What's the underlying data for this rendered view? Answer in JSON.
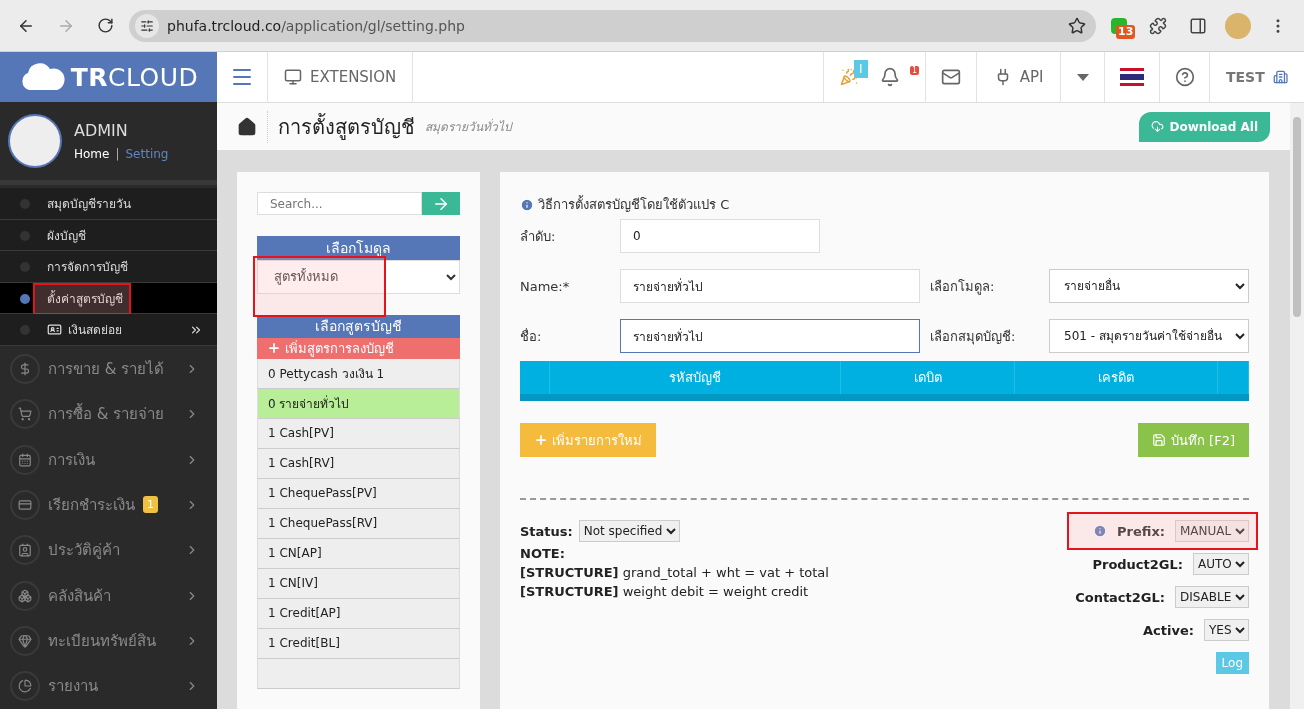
{
  "browser": {
    "url_host": "phufa.trcloud.co",
    "url_path": "/application/gl/setting.php",
    "extension_badge": "13"
  },
  "header": {
    "brand": "**TR**CLOUD",
    "extension": "EXTENSION",
    "party_badge": "I",
    "bell_badge": "1",
    "api": "API",
    "user": "TEST"
  },
  "profile": {
    "name": "ADMIN",
    "separator": "|",
    "links": [
      {
        "label": "Home",
        "selected": false
      },
      {
        "label": "Setting",
        "selected": true
      }
    ]
  },
  "sidebar": {
    "subitems": [
      {
        "label": "สมุดบัญชีรายวัน",
        "selected": false,
        "highlighted": false,
        "kind": "link"
      },
      {
        "label": "ผังบัญชี",
        "selected": false,
        "highlighted": false,
        "kind": "link"
      },
      {
        "label": "การจัดการบัญชี",
        "selected": false,
        "highlighted": false,
        "kind": "link"
      },
      {
        "label": "ตั้งค่าสูตรบัญชี",
        "selected": true,
        "highlighted": true,
        "kind": "link"
      },
      {
        "label": "เงินสดย่อย",
        "selected": false,
        "highlighted": false,
        "kind": "expandable"
      }
    ],
    "menu": [
      {
        "label": "การขาย & รายได้"
      },
      {
        "label": "การซื้อ & รายจ่าย"
      },
      {
        "label": "การเงิน"
      },
      {
        "label": "เรียกชำระเงิน",
        "badge": "1"
      },
      {
        "label": "ประวัติคู่ค้า"
      },
      {
        "label": "คลังสินค้า"
      },
      {
        "label": "ทะเบียนทรัพย์สิน"
      },
      {
        "label": "รายงาน"
      }
    ]
  },
  "page": {
    "title": "การตั้งสูตรบัญชี",
    "subtitle": "สมุดรายวันทั่วไป",
    "download": "Download All"
  },
  "left": {
    "search": {
      "placeholder": "Search..."
    },
    "module_header": "เลือกโมดูล",
    "module_select": {
      "value": "สูตรทั้งหมด",
      "highlighted": true
    },
    "formula_header": "เลือกสูตรบัญชี",
    "add_button": "เพิ่มสูตรการลงบัญชี",
    "formulas": [
      {
        "label": "0 Pettycash วงเงิน 1",
        "selected": false
      },
      {
        "label": "0 รายจ่ายทั่วไป",
        "selected": true
      },
      {
        "label": "1 Cash[PV]",
        "selected": false
      },
      {
        "label": "1 Cash[RV]",
        "selected": false
      },
      {
        "label": "1 ChequePass[PV]",
        "selected": false
      },
      {
        "label": "1 ChequePass[RV]",
        "selected": false
      },
      {
        "label": "1 CN[AP]",
        "selected": false
      },
      {
        "label": "1 CN[IV]",
        "selected": false
      },
      {
        "label": "1 Credit[AP]",
        "selected": false
      },
      {
        "label": "1 Credit[BL]",
        "selected": false
      }
    ]
  },
  "form": {
    "info": "วิธีการตั้งสตรบัญชีโดยใช้ตัวแปร C",
    "order": {
      "label": "ลำดับ:",
      "value": "0"
    },
    "name": {
      "label": "Name:*",
      "value": "รายจ่ายทั่วไป",
      "focused": false
    },
    "module": {
      "label": "เลือกโมดูล:",
      "value": "รายจ่ายอื่น"
    },
    "thai_name": {
      "label": "ชื่อ:",
      "value": "รายจ่ายทั่วไป",
      "focused": true
    },
    "journal": {
      "label": "เลือกสมุดบัญชี:",
      "value": "501 - สมุดรายวันค่าใช้จ่ายอื่น"
    },
    "table": {
      "columns": [
        "รหัสบัญชี",
        "เดบิต",
        "เครดิต"
      ]
    },
    "add_row_button": "เพิ่มรายการใหม่",
    "save_button": "บันทึก [F2]"
  },
  "footer": {
    "status": {
      "label": "Status:",
      "value": "Not specified"
    },
    "note_title": "NOTE:",
    "notes": [
      "**[STRUCTURE]** grand_total + wht = vat + total",
      "**[STRUCTURE]** weight debit = weight credit"
    ],
    "settings": [
      {
        "label": "Prefix:",
        "value": "MANUAL",
        "info": true,
        "highlighted": true
      },
      {
        "label": "Product2GL:",
        "value": "AUTO",
        "info": false,
        "highlighted": false
      },
      {
        "label": "Contact2GL:",
        "value": "DISABLE",
        "info": false,
        "highlighted": false
      },
      {
        "label": "Active:",
        "value": "YES",
        "info": false,
        "highlighted": false
      }
    ],
    "log_button": "Log"
  }
}
